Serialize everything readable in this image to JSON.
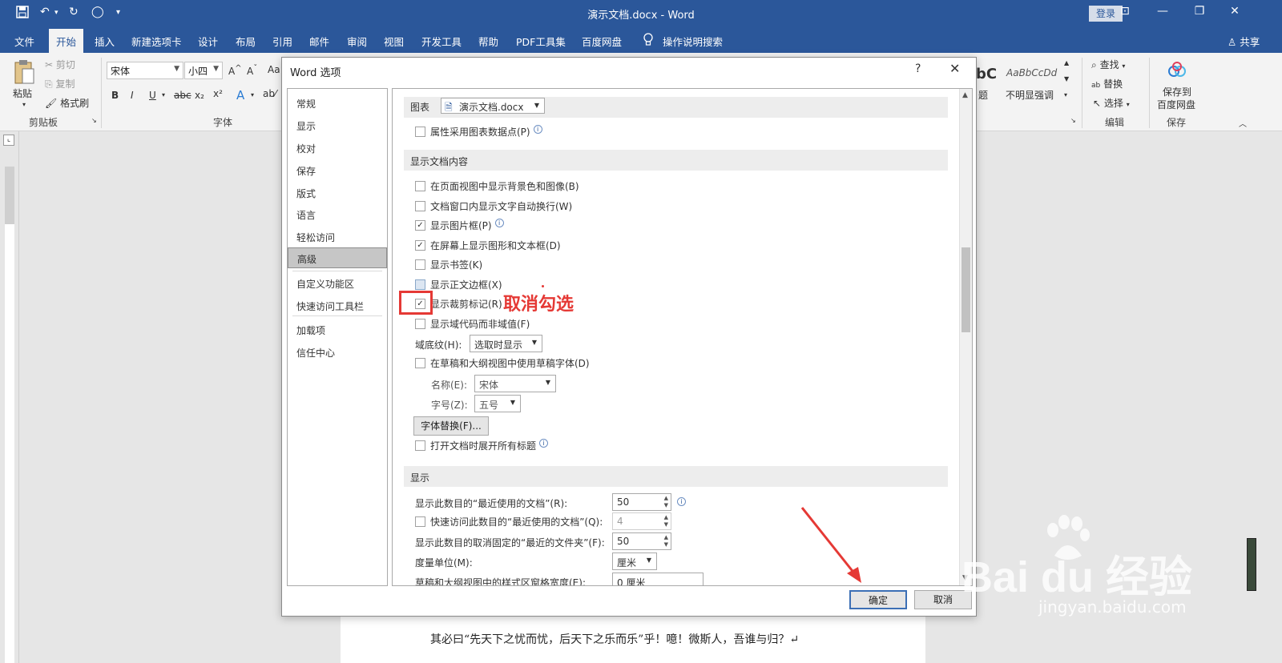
{
  "window": {
    "title": "演示文档.docx  -  Word",
    "login_label": "登录",
    "share_label": "共享"
  },
  "menu_tabs": [
    "文件",
    "开始",
    "插入",
    "新建选项卡",
    "设计",
    "布局",
    "引用",
    "邮件",
    "审阅",
    "视图",
    "开发工具",
    "帮助",
    "PDF工具集",
    "百度网盘"
  ],
  "tell_me": "操作说明搜索",
  "ribbon": {
    "paste": "粘贴",
    "cut": "剪切",
    "copy": "复制",
    "format_painter": "格式刷",
    "clipboard_group": "剪贴板",
    "font_name": "宋体",
    "font_size": "小四",
    "font_group": "字体",
    "style_preview": "AaBbCcDd",
    "style_label": "不明显强调",
    "style_label_partial": "题",
    "style_partial": "bC",
    "find": "查找",
    "replace": "替换",
    "select": "选择",
    "edit_group": "编辑",
    "save_baidu_line1": "保存到",
    "save_baidu_line2": "百度网盘",
    "save_group": "保存"
  },
  "document": {
    "line2": "其必曰“先天下之忧而忧，后天下之乐而乐”乎！噫！微斯人，吾谁与归？↵"
  },
  "dialog": {
    "title": "Word 选项",
    "nav": [
      "常规",
      "显示",
      "校对",
      "保存",
      "版式",
      "语言",
      "轻松访问",
      "高级",
      "自定义功能区",
      "快速访问工具栏",
      "加载项",
      "信任中心"
    ],
    "selected_nav": "高级",
    "chart_label": "图表",
    "chart_doc": "演示文档.docx",
    "opt_chart_props": "属性采用图表数据点(P)",
    "section_show_content": "显示文档内容",
    "options": [
      {
        "label": "在页面视图中显示背景色和图像(B)",
        "checked": false
      },
      {
        "label": "文档窗口内显示文字自动换行(W)",
        "checked": false
      },
      {
        "label": "显示图片框(P)",
        "checked": true
      },
      {
        "label": "在屏幕上显示图形和文本框(D)",
        "checked": true
      },
      {
        "label": "显示书签(K)",
        "checked": false
      },
      {
        "label": "显示正文边框(X)",
        "checked": false
      },
      {
        "label": "显示裁剪标记(R)",
        "checked": true
      },
      {
        "label": "显示域代码而非域值(F)",
        "checked": false
      }
    ],
    "field_shading_label": "域底纹(H):",
    "field_shading_value": "选取时显示",
    "draft_font_label": "在草稿和大纲视图中使用草稿字体(D)",
    "name_label": "名称(E):",
    "name_value": "宋体",
    "size_label": "字号(Z):",
    "size_value": "五号",
    "font_subst_btn": "字体替换(F)...",
    "expand_headings": "打开文档时展开所有标题",
    "section_display": "显示",
    "recent_docs_label": "显示此数目的“最近使用的文档”(R):",
    "recent_docs_value": "50",
    "quick_access_label": "快速访问此数目的“最近使用的文档”(Q):",
    "quick_access_value": "4",
    "unpinned_folders_label": "显示此数目的取消固定的“最近的文件夹”(F):",
    "unpinned_folders_value": "50",
    "units_label": "度量单位(M):",
    "units_value": "厘米",
    "style_pane_label": "草稿和大纲视图中的样式区窗格宽度(E):",
    "style_pane_value": "0 厘米",
    "ok": "确定",
    "cancel": "取消"
  },
  "annotation": {
    "text": "取消勾选",
    "color": "#e53935"
  },
  "watermark": {
    "logo": "Bai du 经验",
    "url": "jingyan.baidu.com"
  },
  "colors": {
    "word_blue": "#2b579a",
    "ribbon_bg": "#f3f3f3"
  }
}
